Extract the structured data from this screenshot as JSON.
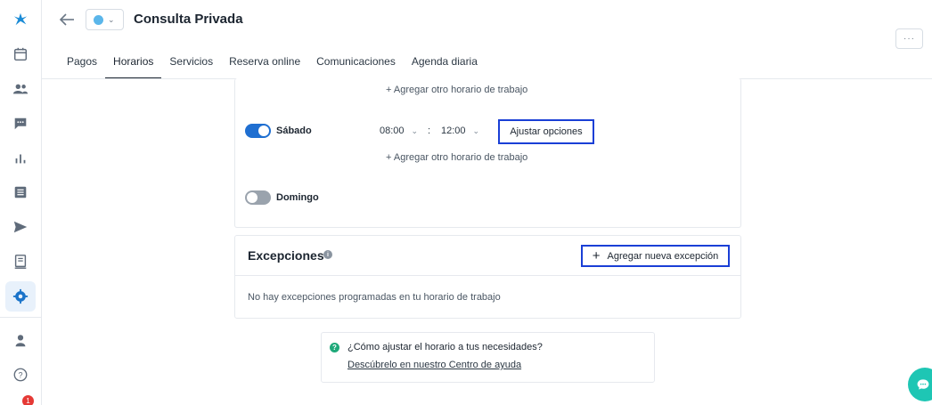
{
  "header": {
    "title": "Consulta Privada",
    "more_label": "···"
  },
  "tabs": [
    {
      "label": "Pagos",
      "active": false
    },
    {
      "label": "Horarios",
      "active": true
    },
    {
      "label": "Servicios",
      "active": false
    },
    {
      "label": "Reserva online",
      "active": false
    },
    {
      "label": "Comunicaciones",
      "active": false
    },
    {
      "label": "Agenda diaria",
      "active": false
    }
  ],
  "schedule": {
    "add_other": "+ Agregar otro horario de trabajo",
    "saturday": {
      "label": "Sábado",
      "enabled": true,
      "start": "08:00",
      "separator": ":",
      "end": "12:00",
      "adjust_label": "Ajustar opciones"
    },
    "sunday": {
      "label": "Domingo",
      "enabled": false
    }
  },
  "exceptions": {
    "title": "Excepciones",
    "add_label": "Agregar nueva excepción",
    "empty_text": "No hay excepciones programadas en tu horario de trabajo"
  },
  "help": {
    "question": "¿Cómo ajustar el horario a tus necesidades?",
    "link": "Descúbrelo en nuestro Centro de ayuda"
  },
  "notifications_count": "1",
  "colors": {
    "brand": "#1a8bd6",
    "highlight": "#1a3fd6",
    "toggle_on": "#1f6fd1",
    "chat": "#1ec6b4"
  }
}
